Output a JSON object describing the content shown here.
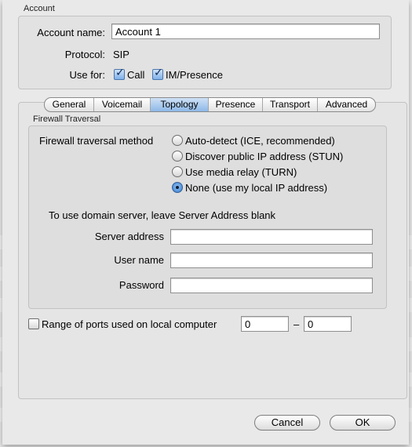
{
  "account": {
    "group_title": "Account",
    "name_label": "Account name:",
    "name_value": "Account 1",
    "protocol_label": "Protocol:",
    "protocol_value": "SIP",
    "use_for_label": "Use for:",
    "call_label": "Call",
    "call_checked": true,
    "im_label": "IM/Presence",
    "im_checked": true
  },
  "tabs": [
    {
      "label": "General",
      "selected": false
    },
    {
      "label": "Voicemail",
      "selected": false
    },
    {
      "label": "Topology",
      "selected": true
    },
    {
      "label": "Presence",
      "selected": false
    },
    {
      "label": "Transport",
      "selected": false
    },
    {
      "label": "Advanced",
      "selected": false
    }
  ],
  "firewall": {
    "group_title": "Firewall Traversal",
    "method_label": "Firewall traversal method",
    "options": [
      {
        "label": "Auto-detect (ICE, recommended)",
        "selected": false
      },
      {
        "label": "Discover public IP address (STUN)",
        "selected": false
      },
      {
        "label": "Use media relay (TURN)",
        "selected": false
      },
      {
        "label": "None (use my local IP address)",
        "selected": true
      }
    ],
    "hint": "To use domain server, leave Server Address blank",
    "server_label": "Server address",
    "server_value": "",
    "user_label": "User name",
    "user_value": "",
    "password_label": "Password",
    "password_value": ""
  },
  "ports": {
    "label": "Range of ports used on local computer",
    "checked": false,
    "from": "0",
    "separator": "–",
    "to": "0"
  },
  "buttons": {
    "cancel": "Cancel",
    "ok": "OK"
  }
}
